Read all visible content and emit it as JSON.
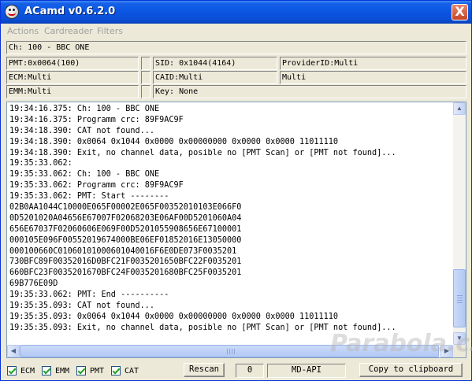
{
  "window": {
    "title": "ACamd v0.6.2.0",
    "close_label": "X"
  },
  "menu": {
    "items": [
      "Actions",
      "Cardreader",
      "Filters"
    ]
  },
  "info": {
    "channel": "Ch: 100 - BBC ONE",
    "pmt": "PMT:0x0064(100)",
    "sid": "SID: 0x1044(4164)",
    "provider": "ProviderID:Multi",
    "ecm": "ECM:Multi",
    "caid": "CAID:Multi",
    "caid_value": "Multi",
    "emm": "EMM:Multi",
    "key": "Key: None"
  },
  "log": [
    "19:34:16.375: Ch: 100 - BBC ONE",
    "19:34:16.375: Programm crc: 89F9AC9F",
    "19:34:18.390: CAT not found...",
    "19:34:18.390: 0x0064 0x1044 0x0000 0x00000000 0x0000 0x0000 11011110",
    "19:34:18.390: Exit, no channel data, posible no [PMT Scan] or [PMT not found]...",
    "19:35:33.062:",
    "19:35:33.062: Ch: 100 - BBC ONE",
    "19:35:33.062: Programm crc: 89F9AC9F",
    "19:35:33.062: PMT: Start --------",
    "02B0AA1044C10000E065F00002E065F00352010103E066F0",
    "0D5201020A04656E67007F02068203E06AF00D5201060A04",
    "656E67037F02060606E069F00D5201055908656E67100001",
    "000105E096F00552019674000BE06EF01852016E13050000",
    "000100660C01060101000601040016F6E0DE073F0035201",
    "730BFC89F00352016D0BFC21F0035201650BFC22F0035201",
    "660BFC23F0035201670BFC24F0035201680BFC25F0035201",
    "69B776E09D",
    "19:35:33.062: PMT: End ----------",
    "19:35:35.093: CAT not found...",
    "19:35:35.093: 0x0064 0x1044 0x0000 0x00000000 0x0000 0x0000 11011110",
    "19:35:35.093: Exit, no channel data, posible no [PMT Scan] or [PMT not found]..."
  ],
  "bottom": {
    "cb_ecm": "ECM",
    "cb_emm": "EMM",
    "cb_pmt": "PMT",
    "cb_cat": "CAT",
    "rescan": "Rescan",
    "counter": "0",
    "mode": "MD-API",
    "copy": "Copy to clipboard"
  },
  "watermark": "Parabola.cz"
}
